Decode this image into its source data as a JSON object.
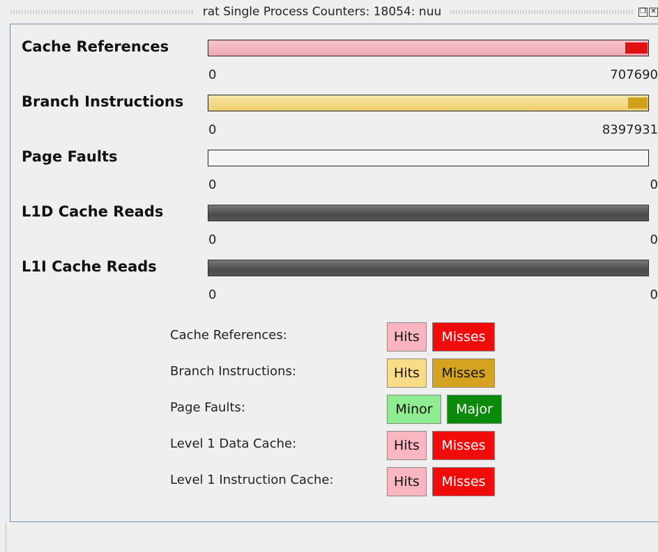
{
  "window": {
    "title": "rat Single Process Counters: 18054: nuu",
    "restore_icon": "restore-icon",
    "close_icon": "close-icon"
  },
  "counters": [
    {
      "label": "Cache References",
      "min": "0",
      "max": "707690",
      "bar_bg": "#f4b5be",
      "marker_color": "#e21111",
      "marker_fraction": 0.05
    },
    {
      "label": "Branch Instructions",
      "min": "0",
      "max": "8397931",
      "bar_bg": "#f5dc86",
      "marker_color": "#d2a11c",
      "marker_fraction": 0.045
    },
    {
      "label": "Page Faults",
      "min": "0",
      "max": "0",
      "bar_bg": "#f4f4f4",
      "marker_color": "",
      "marker_fraction": 0
    },
    {
      "label": "L1D Cache Reads",
      "min": "0",
      "max": "0",
      "bar_bg": "#5a5a5a",
      "marker_color": "",
      "marker_fraction": 0
    },
    {
      "label": "L1I Cache Reads",
      "min": "0",
      "max": "0",
      "bar_bg": "#5a5a5a",
      "marker_color": "",
      "marker_fraction": 0
    }
  ],
  "legend": [
    {
      "label": "Cache References:",
      "chips": [
        {
          "text": "Hits",
          "bg": "#f9b6c1",
          "fg": "#111111"
        },
        {
          "text": "Misses",
          "bg": "#f20b0b",
          "fg": "#ffffff"
        }
      ]
    },
    {
      "label": "Branch Instructions:",
      "chips": [
        {
          "text": "Hits",
          "bg": "#fbdc86",
          "fg": "#111111"
        },
        {
          "text": "Misses",
          "bg": "#d6a321",
          "fg": "#111111"
        }
      ]
    },
    {
      "label": "Page Faults:",
      "chips": [
        {
          "text": "Minor",
          "bg": "#90ec90",
          "fg": "#111111"
        },
        {
          "text": "Major",
          "bg": "#0a8a0a",
          "fg": "#ffffff"
        }
      ]
    },
    {
      "label": "Level 1 Data Cache:",
      "chips": [
        {
          "text": "Hits",
          "bg": "#f9b6c1",
          "fg": "#111111"
        },
        {
          "text": "Misses",
          "bg": "#f20b0b",
          "fg": "#ffffff"
        }
      ]
    },
    {
      "label": "Level 1 Instruction Cache:",
      "chips": [
        {
          "text": "Hits",
          "bg": "#f9b6c1",
          "fg": "#111111"
        },
        {
          "text": "Misses",
          "bg": "#f20b0b",
          "fg": "#ffffff"
        }
      ]
    }
  ]
}
